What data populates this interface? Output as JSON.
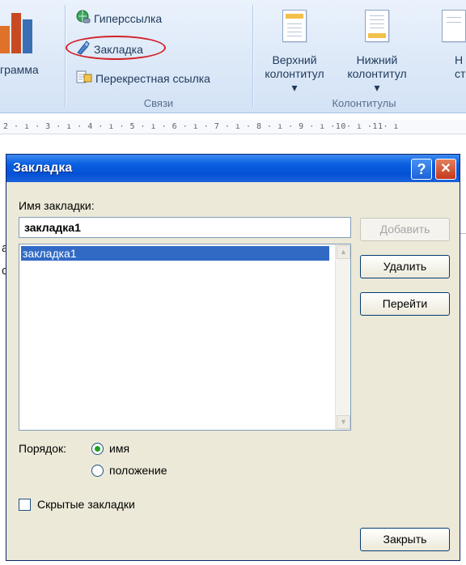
{
  "ribbon": {
    "diagram_label": "грамма",
    "links_group": {
      "hyperlink": "Гиперссылка",
      "bookmark": "Закладка",
      "cross_reference": "Перекрестная ссылка",
      "caption": "Связи"
    },
    "headers_group": {
      "header_line1": "Верхний",
      "header_line2": "колонтитул ▾",
      "footer_line1": "Нижний",
      "footer_line2": "колонтитул ▾",
      "page_number_line1": "Н",
      "page_number_line2": "стра",
      "caption": "Колонтитулы"
    }
  },
  "ruler_text": "2 · ı · 3 · ı · 4 · ı · 5 · ı · 6 · ı · 7 · ı · 8 · ı · 9 · ı ·10· ı ·11· ı",
  "dialog": {
    "title": "Закладка",
    "help_glyph": "?",
    "close_glyph": "✕",
    "name_label": "Имя закладки:",
    "name_value": "закладка1",
    "list_items": [
      "закладка1"
    ],
    "buttons": {
      "add": "Добавить",
      "delete": "Удалить",
      "goto": "Перейти",
      "close": "Закрыть"
    },
    "order_label": "Порядок:",
    "order_options": {
      "name": "имя",
      "position": "положение",
      "selected": "name"
    },
    "hidden_bookmarks_label": "Скрытые закладки",
    "hidden_bookmarks_checked": false
  },
  "colors": {
    "title_bar": "#0451d6",
    "selection": "#316ac5",
    "highlight_circle": "#d2232a",
    "dialog_face": "#ece9d8"
  }
}
